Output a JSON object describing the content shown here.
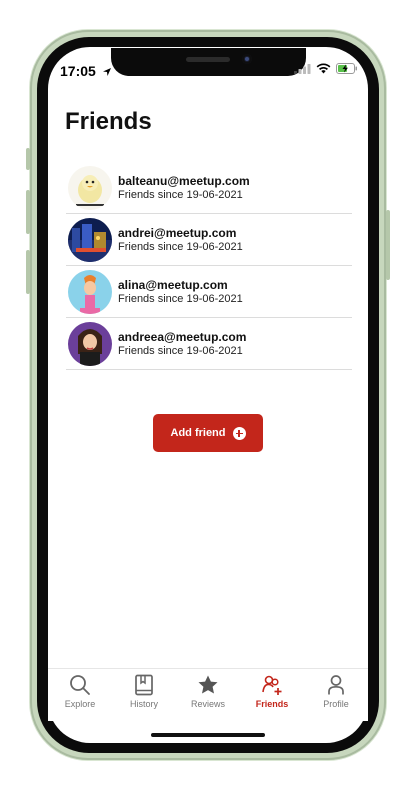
{
  "status_bar": {
    "time": "17:05"
  },
  "page": {
    "title": "Friends"
  },
  "friends": [
    {
      "email": "balteanu@meetup.com",
      "since": "Friends since 19-06-2021",
      "avatar": "duck-avatar"
    },
    {
      "email": "andrei@meetup.com",
      "since": "Friends since 19-06-2021",
      "avatar": "city-night-avatar"
    },
    {
      "email": "alina@meetup.com",
      "since": "Friends since 19-06-2021",
      "avatar": "cartoon-girl-avatar"
    },
    {
      "email": "andreea@meetup.com",
      "since": "Friends since 19-06-2021",
      "avatar": "cartoon-woman-avatar"
    }
  ],
  "actions": {
    "add_friend": "Add friend"
  },
  "tabbar": {
    "items": [
      {
        "label": "Explore",
        "icon": "search-icon"
      },
      {
        "label": "History",
        "icon": "book-icon"
      },
      {
        "label": "Reviews",
        "icon": "star-icon"
      },
      {
        "label": "Friends",
        "icon": "friends-icon",
        "active": true
      },
      {
        "label": "Profile",
        "icon": "person-icon"
      }
    ]
  },
  "colors": {
    "accent": "#c3261b",
    "frame": "#c7d7bd"
  }
}
